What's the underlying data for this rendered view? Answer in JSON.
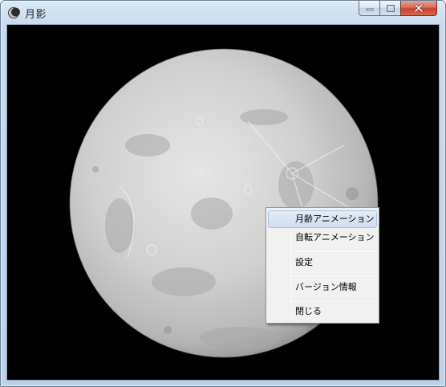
{
  "window": {
    "title": "月影",
    "icons": {
      "app": "moon-app-icon",
      "minimize": "minimize-icon",
      "maximize": "maximize-icon",
      "close": "close-icon"
    }
  },
  "context_menu": {
    "items": [
      {
        "label": "月齢アニメーション",
        "highlighted": true
      },
      {
        "label": "自転アニメーション",
        "highlighted": false
      },
      {
        "label": "設定",
        "highlighted": false
      },
      {
        "label": "バージョン情報",
        "highlighted": false
      },
      {
        "label": "閉じる",
        "highlighted": false
      }
    ]
  },
  "colors": {
    "highlight_border": "#a9c2e0",
    "close_button": "#c7432a",
    "background": "#000000"
  }
}
